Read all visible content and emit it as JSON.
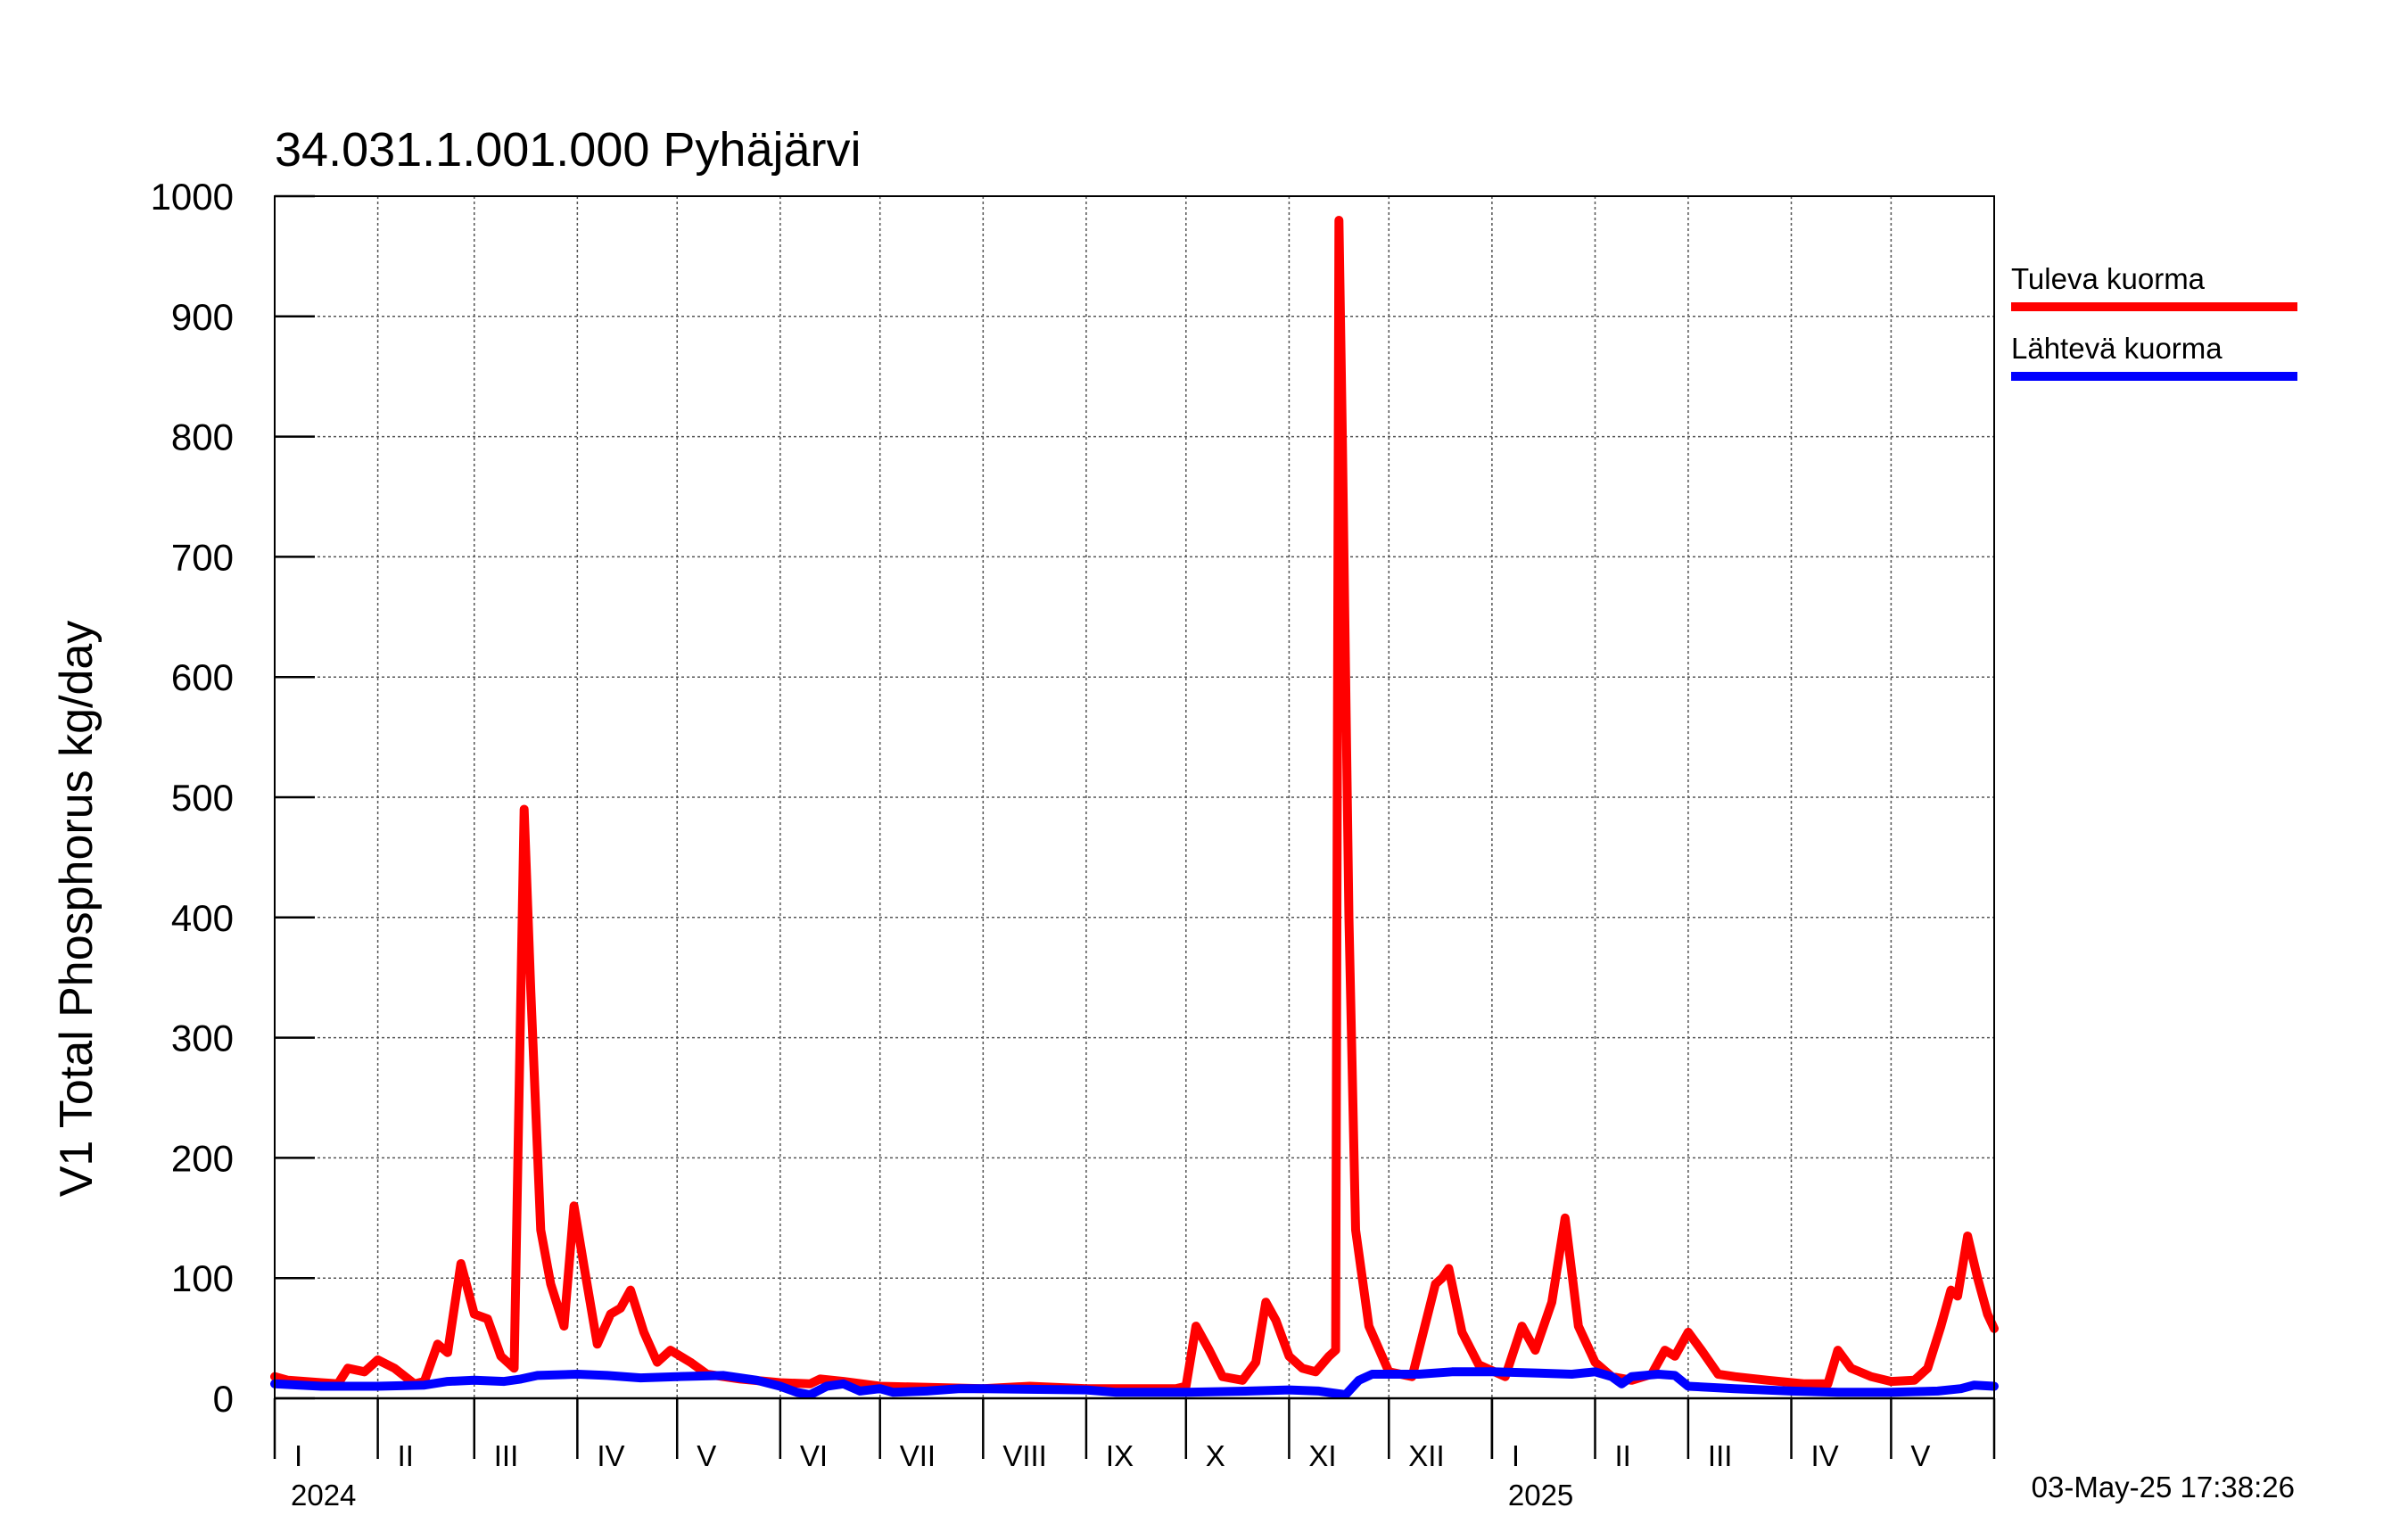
{
  "chart_data": {
    "type": "line",
    "title": "34.031.1.001.000 Pyhäjärvi",
    "ylabel": "V1 Total Phosphorus kg/day",
    "ylim": [
      0,
      1000
    ],
    "yticks": [
      "0",
      "100",
      "200",
      "300",
      "400",
      "500",
      "600",
      "700",
      "800",
      "900",
      "1000"
    ],
    "x_range": [
      "2024-01-01",
      "2025-05-03"
    ],
    "months": [
      {
        "label": "I",
        "start": "2024-01-01"
      },
      {
        "label": "II",
        "start": "2024-02-01"
      },
      {
        "label": "III",
        "start": "2024-03-01"
      },
      {
        "label": "IV",
        "start": "2024-04-01"
      },
      {
        "label": "V",
        "start": "2024-05-01"
      },
      {
        "label": "VI",
        "start": "2024-06-01"
      },
      {
        "label": "VII",
        "start": "2024-07-01"
      },
      {
        "label": "VIII",
        "start": "2024-08-01"
      },
      {
        "label": "IX",
        "start": "2024-09-01"
      },
      {
        "label": "X",
        "start": "2024-10-01"
      },
      {
        "label": "XI",
        "start": "2024-11-01"
      },
      {
        "label": "XII",
        "start": "2024-12-01"
      },
      {
        "label": "I",
        "start": "2025-01-01"
      },
      {
        "label": "II",
        "start": "2025-02-01"
      },
      {
        "label": "III",
        "start": "2025-03-01"
      },
      {
        "label": "IV",
        "start": "2025-04-01"
      },
      {
        "label": "V",
        "start": "2025-05-01"
      }
    ],
    "years": [
      {
        "label": "2024",
        "start": "2024-01-01"
      },
      {
        "label": "2025",
        "start": "2025-01-01"
      }
    ],
    "grid": true,
    "legend_position": "right",
    "series": [
      {
        "name": "Tuleva kuorma",
        "color": "#ff0000",
        "points": [
          [
            "2024-01-01",
            18
          ],
          [
            "2024-01-05",
            15
          ],
          [
            "2024-01-10",
            14
          ],
          [
            "2024-01-15",
            13
          ],
          [
            "2024-01-20",
            12
          ],
          [
            "2024-01-23",
            25
          ],
          [
            "2024-01-28",
            22
          ],
          [
            "2024-02-01",
            32
          ],
          [
            "2024-02-06",
            25
          ],
          [
            "2024-02-12",
            12
          ],
          [
            "2024-02-15",
            14
          ],
          [
            "2024-02-19",
            45
          ],
          [
            "2024-02-22",
            38
          ],
          [
            "2024-02-26",
            112
          ],
          [
            "2024-03-01",
            70
          ],
          [
            "2024-03-05",
            66
          ],
          [
            "2024-03-09",
            35
          ],
          [
            "2024-03-13",
            25
          ],
          [
            "2024-03-16",
            490
          ],
          [
            "2024-03-18",
            340
          ],
          [
            "2024-03-21",
            140
          ],
          [
            "2024-03-24",
            95
          ],
          [
            "2024-03-28",
            60
          ],
          [
            "2024-03-31",
            160
          ],
          [
            "2024-04-03",
            110
          ],
          [
            "2024-04-07",
            45
          ],
          [
            "2024-04-11",
            70
          ],
          [
            "2024-04-14",
            75
          ],
          [
            "2024-04-17",
            90
          ],
          [
            "2024-04-21",
            55
          ],
          [
            "2024-04-25",
            30
          ],
          [
            "2024-04-29",
            40
          ],
          [
            "2024-05-05",
            30
          ],
          [
            "2024-05-10",
            20
          ],
          [
            "2024-05-20",
            16
          ],
          [
            "2024-06-01",
            13
          ],
          [
            "2024-06-10",
            12
          ],
          [
            "2024-06-13",
            16
          ],
          [
            "2024-06-20",
            14
          ],
          [
            "2024-07-01",
            10
          ],
          [
            "2024-08-01",
            8
          ],
          [
            "2024-08-15",
            10
          ],
          [
            "2024-09-01",
            8
          ],
          [
            "2024-09-15",
            8
          ],
          [
            "2024-09-28",
            8
          ],
          [
            "2024-10-01",
            10
          ],
          [
            "2024-10-04",
            60
          ],
          [
            "2024-10-08",
            40
          ],
          [
            "2024-10-12",
            18
          ],
          [
            "2024-10-18",
            15
          ],
          [
            "2024-10-22",
            30
          ],
          [
            "2024-10-25",
            80
          ],
          [
            "2024-10-28",
            65
          ],
          [
            "2024-11-01",
            35
          ],
          [
            "2024-11-05",
            25
          ],
          [
            "2024-11-09",
            22
          ],
          [
            "2024-11-13",
            35
          ],
          [
            "2024-11-15",
            40
          ],
          [
            "2024-11-16",
            980
          ],
          [
            "2024-11-17",
            800
          ],
          [
            "2024-11-19",
            400
          ],
          [
            "2024-11-21",
            140
          ],
          [
            "2024-11-25",
            60
          ],
          [
            "2024-12-01",
            22
          ],
          [
            "2024-12-08",
            18
          ],
          [
            "2024-12-15",
            95
          ],
          [
            "2024-12-17",
            100
          ],
          [
            "2024-12-19",
            108
          ],
          [
            "2024-12-23",
            55
          ],
          [
            "2024-12-28",
            28
          ],
          [
            "2025-01-05",
            18
          ],
          [
            "2025-01-10",
            60
          ],
          [
            "2025-01-14",
            40
          ],
          [
            "2025-01-19",
            80
          ],
          [
            "2025-01-23",
            150
          ],
          [
            "2025-01-27",
            60
          ],
          [
            "2025-02-01",
            30
          ],
          [
            "2025-02-06",
            18
          ],
          [
            "2025-02-12",
            15
          ],
          [
            "2025-02-18",
            20
          ],
          [
            "2025-02-22",
            40
          ],
          [
            "2025-02-25",
            35
          ],
          [
            "2025-03-01",
            55
          ],
          [
            "2025-03-05",
            40
          ],
          [
            "2025-03-10",
            20
          ],
          [
            "2025-03-15",
            18
          ],
          [
            "2025-03-25",
            15
          ],
          [
            "2025-04-05",
            12
          ],
          [
            "2025-04-12",
            12
          ],
          [
            "2025-04-15",
            40
          ],
          [
            "2025-04-19",
            25
          ],
          [
            "2025-04-25",
            18
          ],
          [
            "2025-05-01",
            14
          ],
          [
            "2025-05-08",
            15
          ],
          [
            "2025-05-12",
            25
          ],
          [
            "2025-05-16",
            60
          ],
          [
            "2025-05-19",
            90
          ],
          [
            "2025-05-21",
            85
          ],
          [
            "2025-05-24",
            135
          ],
          [
            "2025-05-27",
            100
          ],
          [
            "2025-05-30",
            70
          ],
          [
            "2025-06-01",
            58
          ]
        ]
      },
      {
        "name": "Lähtevä kuorma",
        "color": "#0000ff",
        "points": [
          [
            "2024-01-01",
            12
          ],
          [
            "2024-01-15",
            10
          ],
          [
            "2024-02-01",
            10
          ],
          [
            "2024-02-15",
            11
          ],
          [
            "2024-02-22",
            14
          ],
          [
            "2024-03-01",
            15
          ],
          [
            "2024-03-10",
            14
          ],
          [
            "2024-03-15",
            16
          ],
          [
            "2024-03-20",
            19
          ],
          [
            "2024-04-01",
            20
          ],
          [
            "2024-04-10",
            19
          ],
          [
            "2024-04-20",
            17
          ],
          [
            "2024-05-01",
            18
          ],
          [
            "2024-05-15",
            19
          ],
          [
            "2024-05-25",
            15
          ],
          [
            "2024-06-01",
            10
          ],
          [
            "2024-06-06",
            5
          ],
          [
            "2024-06-10",
            3
          ],
          [
            "2024-06-15",
            10
          ],
          [
            "2024-06-20",
            12
          ],
          [
            "2024-06-25",
            6
          ],
          [
            "2024-07-01",
            8
          ],
          [
            "2024-07-05",
            5
          ],
          [
            "2024-07-15",
            6
          ],
          [
            "2024-07-25",
            8
          ],
          [
            "2024-08-01",
            8
          ],
          [
            "2024-09-01",
            7
          ],
          [
            "2024-09-10",
            5
          ],
          [
            "2024-10-01",
            5
          ],
          [
            "2024-10-20",
            6
          ],
          [
            "2024-11-01",
            7
          ],
          [
            "2024-11-10",
            6
          ],
          [
            "2024-11-18",
            3
          ],
          [
            "2024-11-22",
            15
          ],
          [
            "2024-11-26",
            20
          ],
          [
            "2024-12-01",
            20
          ],
          [
            "2024-12-10",
            20
          ],
          [
            "2024-12-20",
            22
          ],
          [
            "2025-01-01",
            22
          ],
          [
            "2025-01-15",
            21
          ],
          [
            "2025-01-25",
            20
          ],
          [
            "2025-02-01",
            22
          ],
          [
            "2025-02-06",
            18
          ],
          [
            "2025-02-09",
            12
          ],
          [
            "2025-02-12",
            18
          ],
          [
            "2025-02-20",
            20
          ],
          [
            "2025-02-25",
            19
          ],
          [
            "2025-03-01",
            10
          ],
          [
            "2025-03-15",
            8
          ],
          [
            "2025-04-01",
            6
          ],
          [
            "2025-04-15",
            5
          ],
          [
            "2025-05-01",
            5
          ],
          [
            "2025-05-15",
            6
          ],
          [
            "2025-05-22",
            8
          ],
          [
            "2025-05-26",
            11
          ],
          [
            "2025-06-01",
            10
          ]
        ]
      }
    ],
    "timestamp": "03-May-25 17:38:26"
  }
}
